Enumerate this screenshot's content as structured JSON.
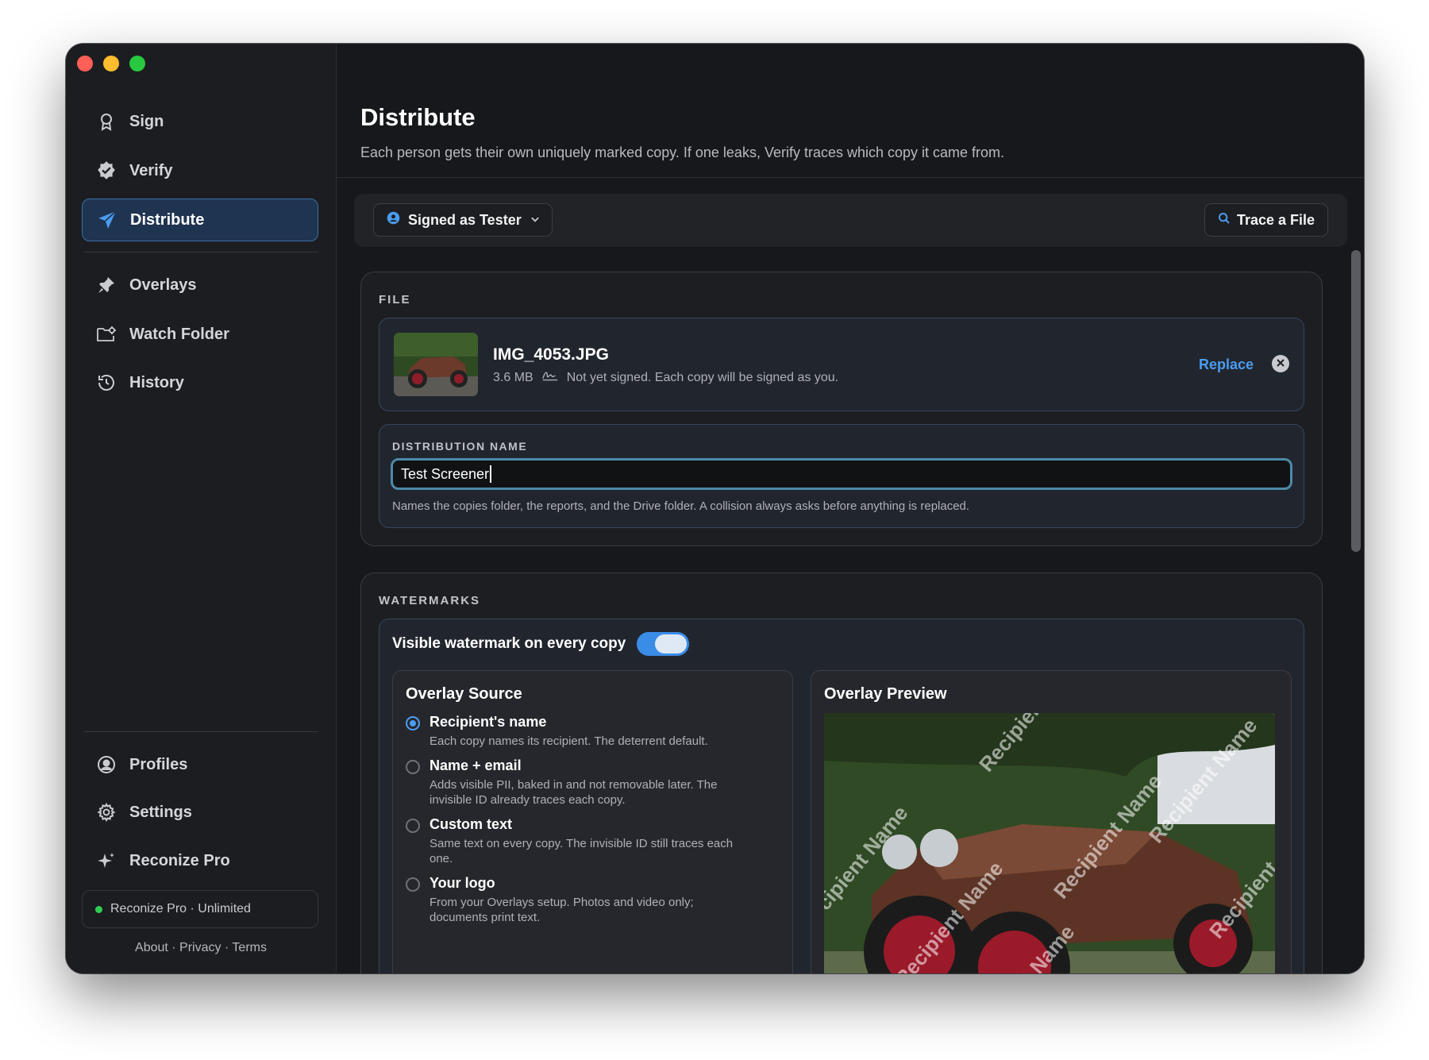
{
  "sidebar": {
    "items": [
      {
        "label": "Sign",
        "icon": "ribbon-icon"
      },
      {
        "label": "Verify",
        "icon": "verified-badge-icon"
      },
      {
        "label": "Distribute",
        "icon": "paper-plane-icon"
      },
      {
        "label": "Overlays",
        "icon": "stamp-icon"
      },
      {
        "label": "Watch Folder",
        "icon": "folder-gear-icon"
      },
      {
        "label": "History",
        "icon": "history-clock-icon"
      },
      {
        "label": "Profiles",
        "icon": "person-circle-icon"
      },
      {
        "label": "Settings",
        "icon": "gear-icon"
      },
      {
        "label": "Reconize Pro",
        "icon": "sparkle-icon"
      }
    ],
    "pro_status": "Reconize Pro · Unlimited",
    "footer_links": "About · Privacy · Terms"
  },
  "header": {
    "title": "Distribute",
    "subtitle": "Each person gets their own uniquely marked copy. If one leaks, Verify traces which copy it came from."
  },
  "toolbar": {
    "signed_as": "Signed as Tester",
    "trace_label": "Trace a File"
  },
  "file_section": {
    "label": "FILE",
    "file_name": "IMG_4053.JPG",
    "file_size": "3.6 MB",
    "status": "Not yet signed. Each copy will be signed as you.",
    "replace_label": "Replace"
  },
  "distribution": {
    "label": "DISTRIBUTION NAME",
    "value": "Test Screener",
    "helper": "Names the copies folder, the reports, and the Drive folder. A collision always asks before anything is replaced."
  },
  "watermarks": {
    "label": "WATERMARKS",
    "toggle_label": "Visible watermark on every copy",
    "toggle_on": true,
    "source_title": "Overlay Source",
    "preview_title": "Overlay Preview",
    "options": [
      {
        "title": "Recipient's name",
        "desc": "Each copy names its recipient. The deterrent default.",
        "selected": true
      },
      {
        "title": "Name + email",
        "desc": "Adds visible PII, baked in and not removable later. The invisible ID already traces each copy.",
        "selected": false
      },
      {
        "title": "Custom text",
        "desc": "Same text on every copy. The invisible ID still traces each one.",
        "selected": false
      },
      {
        "title": "Your logo",
        "desc": "From your Overlays setup. Photos and video only; documents print text.",
        "selected": false
      }
    ],
    "preview_watermark": [
      "Recipient Name",
      "Recipient Name",
      "Recipient Name",
      "Recipient",
      "Recipient Name",
      "Recipient",
      "Recipient Name"
    ]
  },
  "colors": {
    "accent": "#4a9cf0",
    "active_bg": "#1f3450",
    "window_bg": "#17181b"
  }
}
